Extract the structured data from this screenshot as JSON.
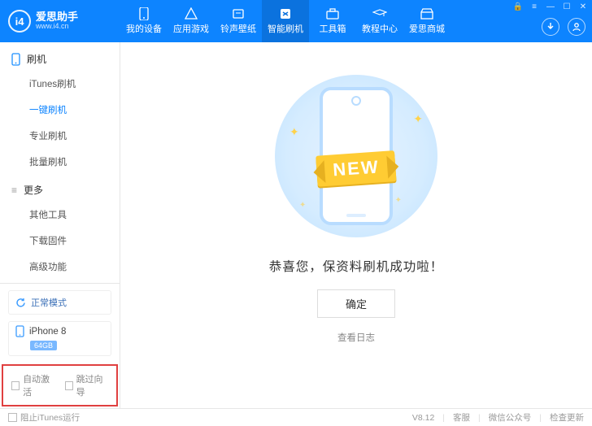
{
  "header": {
    "logo_initials": "i4",
    "brand_name": "爱思助手",
    "brand_url": "www.i4.cn",
    "nav": [
      {
        "label": "我的设备"
      },
      {
        "label": "应用游戏"
      },
      {
        "label": "铃声壁纸"
      },
      {
        "label": "智能刷机"
      },
      {
        "label": "工具箱"
      },
      {
        "label": "教程中心"
      },
      {
        "label": "爱思商城"
      }
    ]
  },
  "sidebar": {
    "group1_title": "刷机",
    "items1": [
      {
        "label": "iTunes刷机"
      },
      {
        "label": "一键刷机"
      },
      {
        "label": "专业刷机"
      },
      {
        "label": "批量刷机"
      }
    ],
    "group2_title": "更多",
    "items2": [
      {
        "label": "其他工具"
      },
      {
        "label": "下载固件"
      },
      {
        "label": "高级功能"
      }
    ],
    "mode_label": "正常模式",
    "device_name": "iPhone 8",
    "device_storage": "64GB",
    "checkbox_auto_activate": "自动激活",
    "checkbox_skip_guide": "跳过向导"
  },
  "main": {
    "ribbon_text": "NEW",
    "success_message": "恭喜您，保资料刷机成功啦！",
    "ok_button": "确定",
    "view_log": "查看日志"
  },
  "footer": {
    "block_itunes": "阻止iTunes运行",
    "version": "V8.12",
    "link_support": "客服",
    "link_wechat": "微信公众号",
    "link_update": "检查更新"
  }
}
